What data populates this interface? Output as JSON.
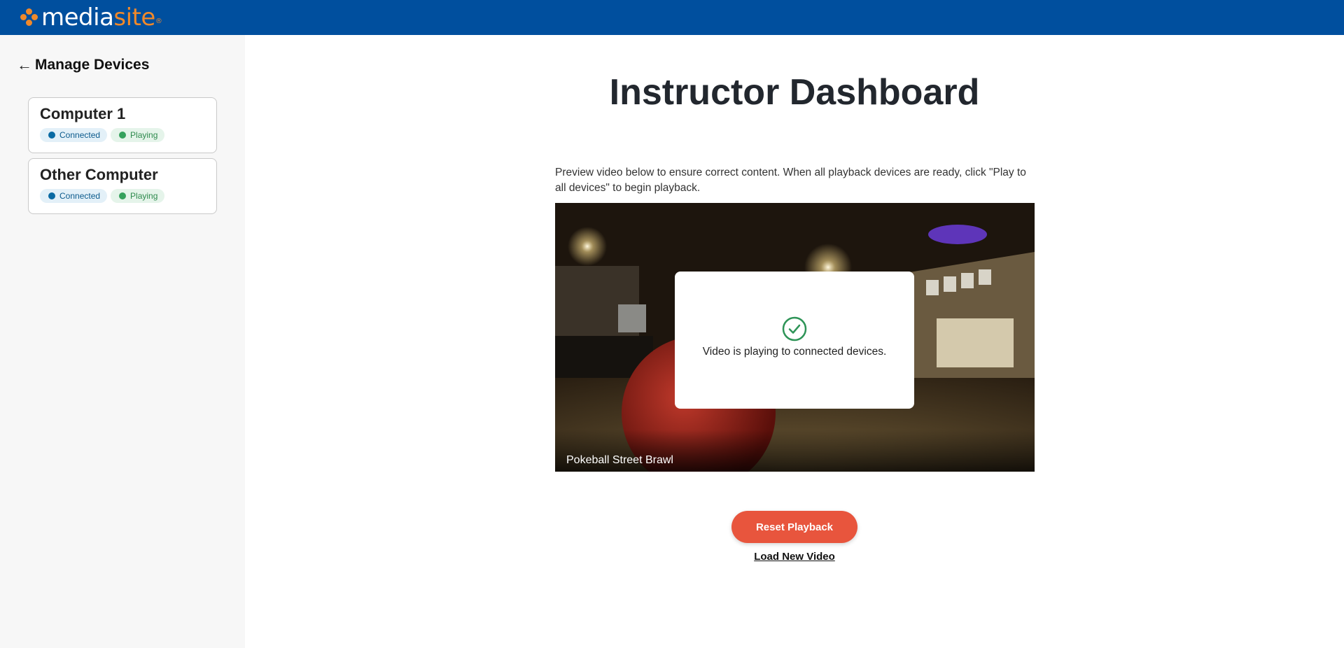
{
  "header": {
    "logo_media": "media",
    "logo_site": "site",
    "logo_reg": "®",
    "brand_color": "#004f9e",
    "accent_color": "#f0892a"
  },
  "sidebar": {
    "back_icon": "arrow-left-icon",
    "back_arrow": "←",
    "title": "Manage Devices",
    "devices": [
      {
        "name": "Computer 1",
        "status_connected": "Connected",
        "status_playing": "Playing"
      },
      {
        "name": "Other Computer",
        "status_connected": "Connected",
        "status_playing": "Playing"
      }
    ]
  },
  "main": {
    "title": "Instructor Dashboard",
    "instructions": "Preview video below to ensure correct content. When all playback devices are ready, click \"Play to all devices\" to begin playback.",
    "video": {
      "caption": "Pokeball Street Brawl",
      "overlay_icon": "check-circle-icon",
      "overlay_message": "Video is playing to connected devices."
    },
    "reset_button_label": "Reset Playback",
    "load_link_label": "Load New Video",
    "reset_color": "#e8553d"
  }
}
